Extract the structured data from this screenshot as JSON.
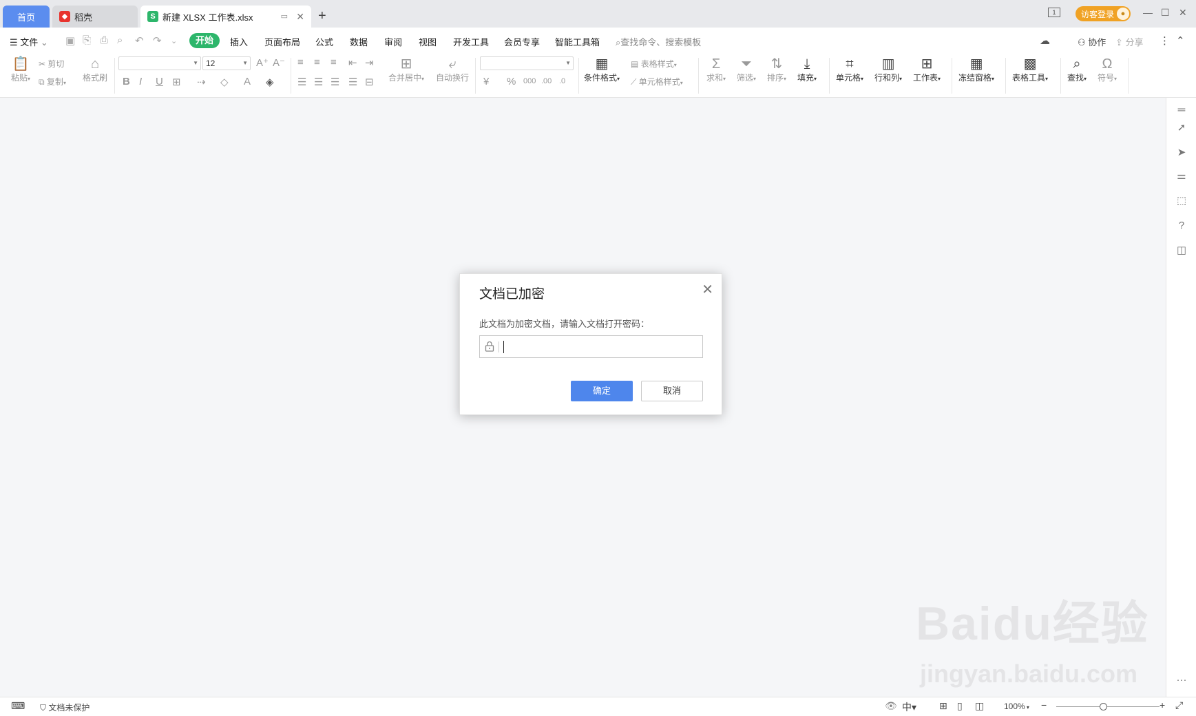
{
  "titlebar": {
    "tabs": [
      {
        "label": "首页"
      },
      {
        "label": "稻壳"
      },
      {
        "label": "新建 XLSX 工作表.xlsx"
      }
    ],
    "add_tab": "+",
    "login_label": "访客登录",
    "window_count": "1"
  },
  "menubar": {
    "file": "文件",
    "items": [
      "开始",
      "插入",
      "页面布局",
      "公式",
      "数据",
      "审阅",
      "视图",
      "开发工具",
      "会员专享",
      "智能工具箱"
    ],
    "search_placeholder": "查找命令、搜索模板",
    "collab": "协作",
    "share": "分享"
  },
  "ribbon": {
    "paste": "粘贴",
    "cut": "剪切",
    "copy": "复制",
    "format_painter": "格式刷",
    "font_name": "",
    "font_size": "12",
    "merge_center": "合并居中",
    "auto_wrap": "自动换行",
    "number_format": "",
    "conditional_format": "条件格式",
    "table_style": "表格样式",
    "cell_style": "单元格样式",
    "sum": "求和",
    "filter": "筛选",
    "sort": "排序",
    "fill": "填充",
    "cell": "单元格",
    "row_col": "行和列",
    "worksheet": "工作表",
    "freeze": "冻结窗格",
    "table_tools": "表格工具",
    "find": "查找",
    "symbol": "符号"
  },
  "dialog": {
    "title": "文档已加密",
    "message": "此文档为加密文档，请输入文档打开密码：",
    "password_value": "",
    "ok": "确定",
    "cancel": "取消"
  },
  "statusbar": {
    "protect": "文档未保护",
    "zoom": "100%"
  },
  "watermark": {
    "text": "Baidu经验",
    "url": "jingyan.baidu.com"
  }
}
